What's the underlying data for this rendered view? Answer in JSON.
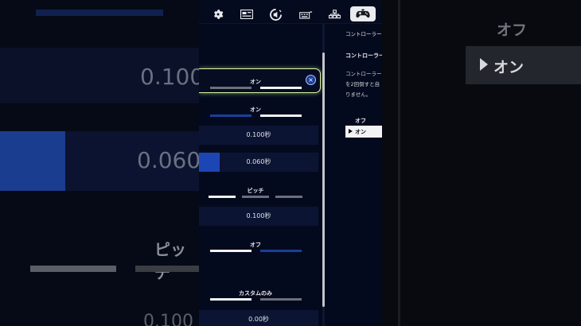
{
  "background_left": {
    "value_1": "0.100",
    "value_2": "0.060",
    "label_3": "ピッチ",
    "value_4": "0.100"
  },
  "background_right": {
    "option_off": "オフ",
    "option_on": "オン"
  },
  "tabs": [
    {
      "icon": "gear-icon"
    },
    {
      "icon": "display-icon"
    },
    {
      "icon": "audio-icon"
    },
    {
      "icon": "keyboard-icon"
    },
    {
      "icon": "network-icon"
    },
    {
      "icon": "controller-icon",
      "active": true
    }
  ],
  "settings": {
    "row1_value": "オン",
    "row2_value": "オン",
    "row3_value": "0.100秒",
    "row4_value": "0.060秒",
    "row4_fill_fraction": 0.17,
    "row5_value": "ピッチ",
    "row6_value": "0.100秒",
    "row7_value": "オフ",
    "row8_value": "カスタムのみ",
    "row9_value": "0.00秒"
  },
  "description": {
    "title": "コントローラー",
    "heading": "コントローラー",
    "body_line1": "コントローラー",
    "body_line2": "を2回倒すと自",
    "body_line3": "りません。",
    "option_off": "オフ",
    "option_on": "オン"
  },
  "colors": {
    "accent_blue": "#1c3e99",
    "focus_outline": "#d6f5a4",
    "panel_bg": "#040a1e"
  }
}
